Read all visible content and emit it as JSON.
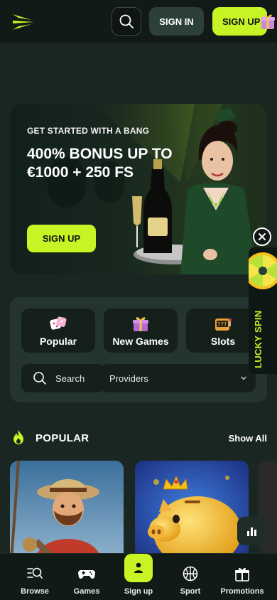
{
  "header": {
    "logo_icon": "lightning-wings-icon",
    "search_icon": "search-icon",
    "signin_label": "SIGN IN",
    "signup_label": "SIGN UP",
    "gift_icon": "gift-icon"
  },
  "hero": {
    "eyebrow": "GET STARTED WITH A BANG",
    "title": "400% BONUS UP TO €1000 + 250 FS",
    "cta_label": "SIGN UP"
  },
  "lucky_spin": {
    "label": "LUCKY SPIN",
    "close_icon": "close-icon",
    "wheel_icon": "prize-wheel-icon"
  },
  "categories": [
    {
      "label": "Popular",
      "icon": "dice-icon"
    },
    {
      "label": "New Games",
      "icon": "gift-icon"
    },
    {
      "label": "Slots",
      "icon": "slot-machine-icon"
    }
  ],
  "filters": {
    "search_label": "Search",
    "providers_label": "Providers"
  },
  "popular": {
    "title": "POPULAR",
    "show_all": "Show All",
    "icon": "flame-icon"
  },
  "games": [
    {
      "name": "fisherman-game",
      "art": "cowboy-fisherman"
    },
    {
      "name": "piggy-game",
      "art": "golden-piggy-bank"
    }
  ],
  "bottom_nav": [
    {
      "label": "Browse",
      "icon": "browse-icon"
    },
    {
      "label": "Games",
      "icon": "gamepad-icon"
    },
    {
      "label": "Sign up",
      "icon": "user-icon"
    },
    {
      "label": "Sport",
      "icon": "basketball-icon"
    },
    {
      "label": "Promotions",
      "icon": "gift-box-icon"
    }
  ],
  "colors": {
    "accent": "#c6f425",
    "background": "#1a2622",
    "header": "#111a17",
    "panel": "#24352f",
    "tile": "#142019"
  }
}
